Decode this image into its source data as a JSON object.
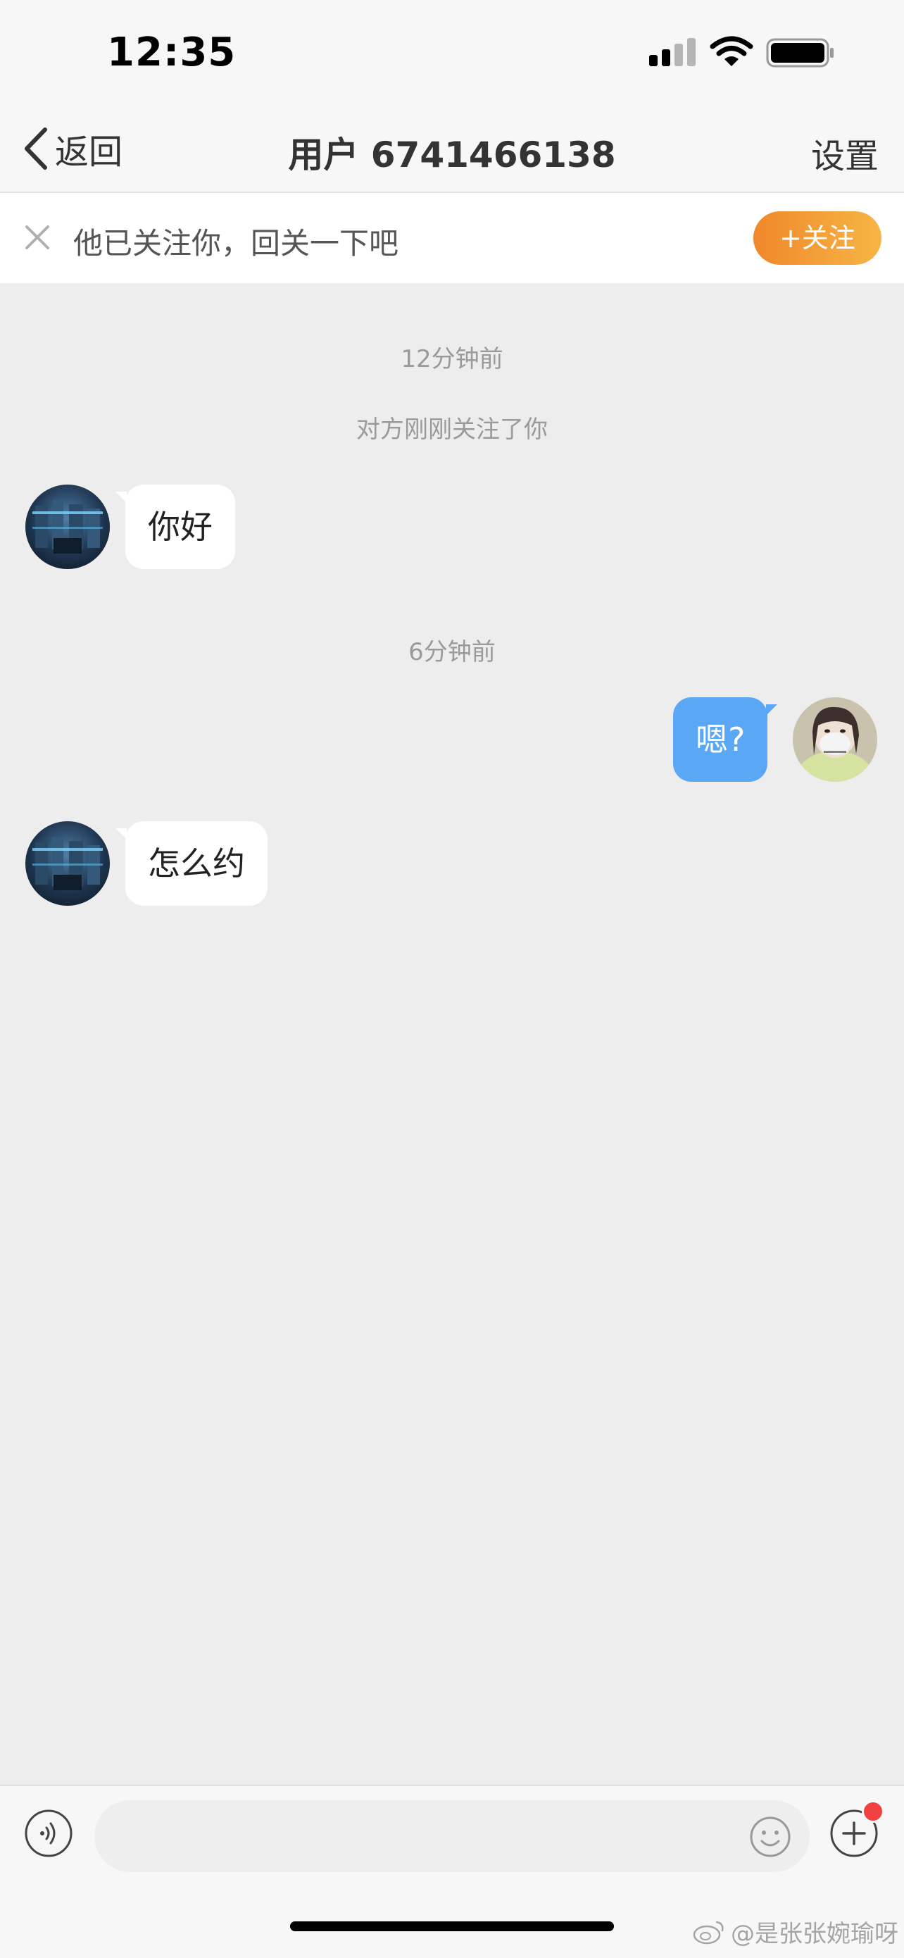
{
  "status_bar": {
    "time": "12:35"
  },
  "nav": {
    "back_label": "返回",
    "title": "用户 6741466138",
    "settings_label": "设置"
  },
  "follow_banner": {
    "text": "他已关注你，回关一下吧",
    "follow_button": "+关注"
  },
  "chat": {
    "items": [
      {
        "type": "time",
        "text": "12分钟前"
      },
      {
        "type": "system",
        "text": "对方刚刚关注了你"
      },
      {
        "type": "message",
        "side": "left",
        "text": "你好"
      },
      {
        "type": "time",
        "text": "6分钟前"
      },
      {
        "type": "message",
        "side": "right",
        "text": "嗯?"
      },
      {
        "type": "message",
        "side": "left",
        "text": "怎么约"
      }
    ]
  },
  "input_bar": {
    "placeholder": "",
    "icons": [
      "voice-icon",
      "emoji-icon",
      "plus-icon"
    ]
  },
  "watermark": {
    "text": "@是张张婉瑜呀"
  },
  "colors": {
    "background": "#ededed",
    "my_bubble": "#5aa7f6",
    "follow_button": "#f39c35",
    "notification_dot": "#f04040"
  }
}
